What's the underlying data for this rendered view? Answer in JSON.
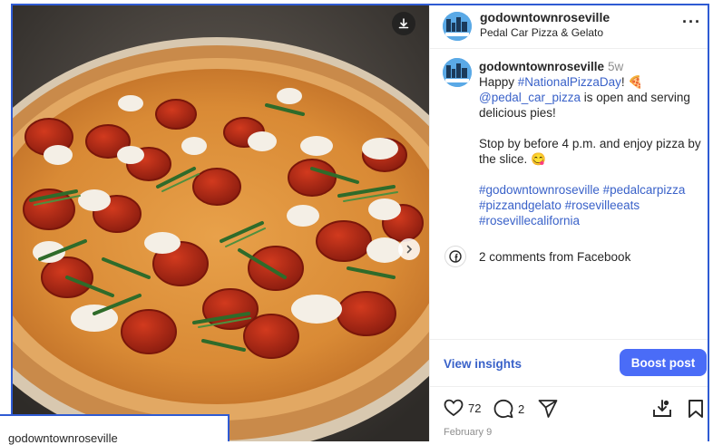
{
  "post": {
    "username": "godowntownroseville",
    "location": "Pedal Car Pizza & Gelato",
    "time_ago": "5w",
    "more_label": "···",
    "caption": {
      "line1_pre": "Happy ",
      "hashtag1": "#NationalPizzaDay",
      "line1_post": "! 🍕",
      "mention": "@pedal_car_pizza",
      "line2_post": " is open and serving delicious pies!",
      "para2": "Stop by before 4 p.m. and enjoy pizza by the slice. 😋",
      "hashtags": [
        "#godowntownroseville",
        "#pedalcarpizza",
        "#pizzandgelato",
        "#rosevilleeats",
        "#rosevillecalifornia"
      ]
    },
    "comments_label": "2 comments from Facebook",
    "view_insights": "View insights",
    "boost_post": "Boost post",
    "likes": "72",
    "comments": "2",
    "date": "February 9"
  },
  "overlay_window": {
    "title": "godowntownroseville"
  },
  "colors": {
    "link": "#3a62c9",
    "boost": "#4a6cf7",
    "frame": "#2f5bd3"
  },
  "icons": [
    "download-icon",
    "chevron-right-icon",
    "more-icon",
    "facebook-icon",
    "heart-icon",
    "comment-icon",
    "share-icon",
    "insights-download-icon",
    "bookmark-icon"
  ]
}
